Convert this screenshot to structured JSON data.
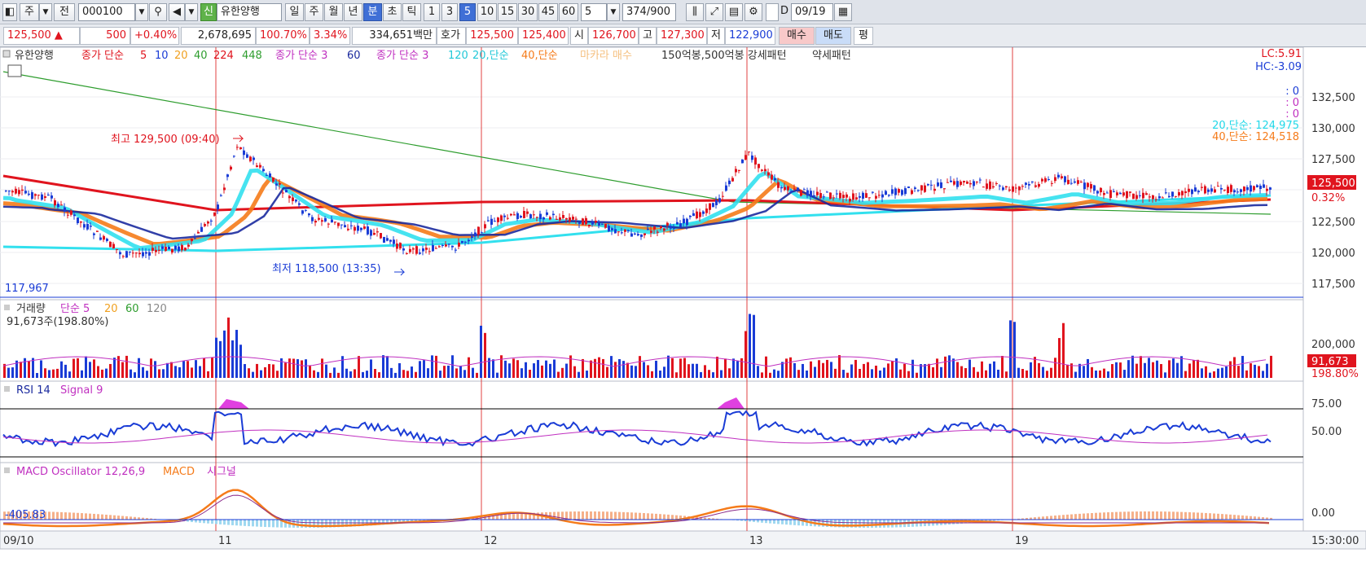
{
  "toolbar": {
    "type_label": "주",
    "prev_label": "전",
    "code": "000100",
    "new_badge": "신",
    "stock_name": "유한양행",
    "periods": [
      "일",
      "주",
      "월",
      "년",
      "분",
      "초",
      "틱"
    ],
    "active_period": "분",
    "intervals": [
      "1",
      "3",
      "5",
      "10",
      "15",
      "30",
      "45",
      "60"
    ],
    "active_interval": "5",
    "interval_select": "5",
    "count": "374",
    "count_total": "/900",
    "d_label": "D",
    "date": "09/19"
  },
  "quote": {
    "price": "125,500",
    "change": "500",
    "change_pct": "+0.40%",
    "volume": "2,678,695",
    "volume_ratio": "100.70%",
    "turnover": "3.34%",
    "amount": "334,651백만",
    "hoga_label": "호가",
    "ask": "125,500",
    "bid": "125,400",
    "open_label": "시",
    "open": "126,700",
    "high_label": "고",
    "high": "127,300",
    "low_label": "저",
    "low": "122,900",
    "buy_label": "매수",
    "sell_label": "매도",
    "eval_label": "평"
  },
  "legend": {
    "name": "유한양행",
    "ma1_label": "종가 단순",
    "ma1_periods": [
      "5",
      "10",
      "20",
      "40",
      "224",
      "448"
    ],
    "ma2_label": "종가 단순 3",
    "ma2_period": "60",
    "ma3_label": "종가 단순 3",
    "ma3_period": "120",
    "ma20": "20,단순",
    "ma40": "40,단순",
    "macara": "마카라 매수",
    "patterns": "150억봉,500억봉 강세패턴",
    "weak": "약세패턴"
  },
  "price_pane": {
    "lc": "LC:5.91",
    "hc": "HC:-3.09",
    "zeros": [
      ": 0",
      ": 0",
      ": 0"
    ],
    "ma20_value": "20,단순: 124,975",
    "ma40_value": "40,단순: 124,518",
    "high_note": "최고 129,500 (09:40)",
    "low_note": "최저 118,500 (13:35)",
    "base_line": "117,967",
    "current_price": "125,500",
    "current_pct": "0.32%",
    "y_ticks": [
      "132,500",
      "130,000",
      "127,500",
      "125,000",
      "122,500",
      "120,000",
      "117,500"
    ]
  },
  "volume_pane": {
    "title": "거래량",
    "ma_label": "단순 5",
    "ma_periods": [
      "20",
      "60",
      "120"
    ],
    "value": "91,673주(198.80%)",
    "y_tick": "200,000",
    "current": "91,673",
    "current_pct": "198.80%"
  },
  "rsi_pane": {
    "title": "RSI 14",
    "signal": "Signal 9",
    "y_ticks": [
      "75.00",
      "50.00"
    ]
  },
  "macd_pane": {
    "title": "MACD Oscillator 12,26,9",
    "macd": "MACD",
    "signal": "시그널",
    "left_value": "-405.83",
    "y_tick": "0.00"
  },
  "x_axis": {
    "labels": [
      "09/10",
      "11",
      "12",
      "13",
      "19"
    ],
    "time": "15:30:00"
  },
  "colors": {
    "up": "#e0141e",
    "down": "#1a3cd6",
    "ma5": "#e0141e",
    "ma10": "#1a3cd6",
    "ma20": "#f0a020",
    "ma40": "#2e9d2e",
    "cyan": "#32e0ee",
    "orange": "#f57b1a",
    "navy": "#1b2a9e"
  }
}
